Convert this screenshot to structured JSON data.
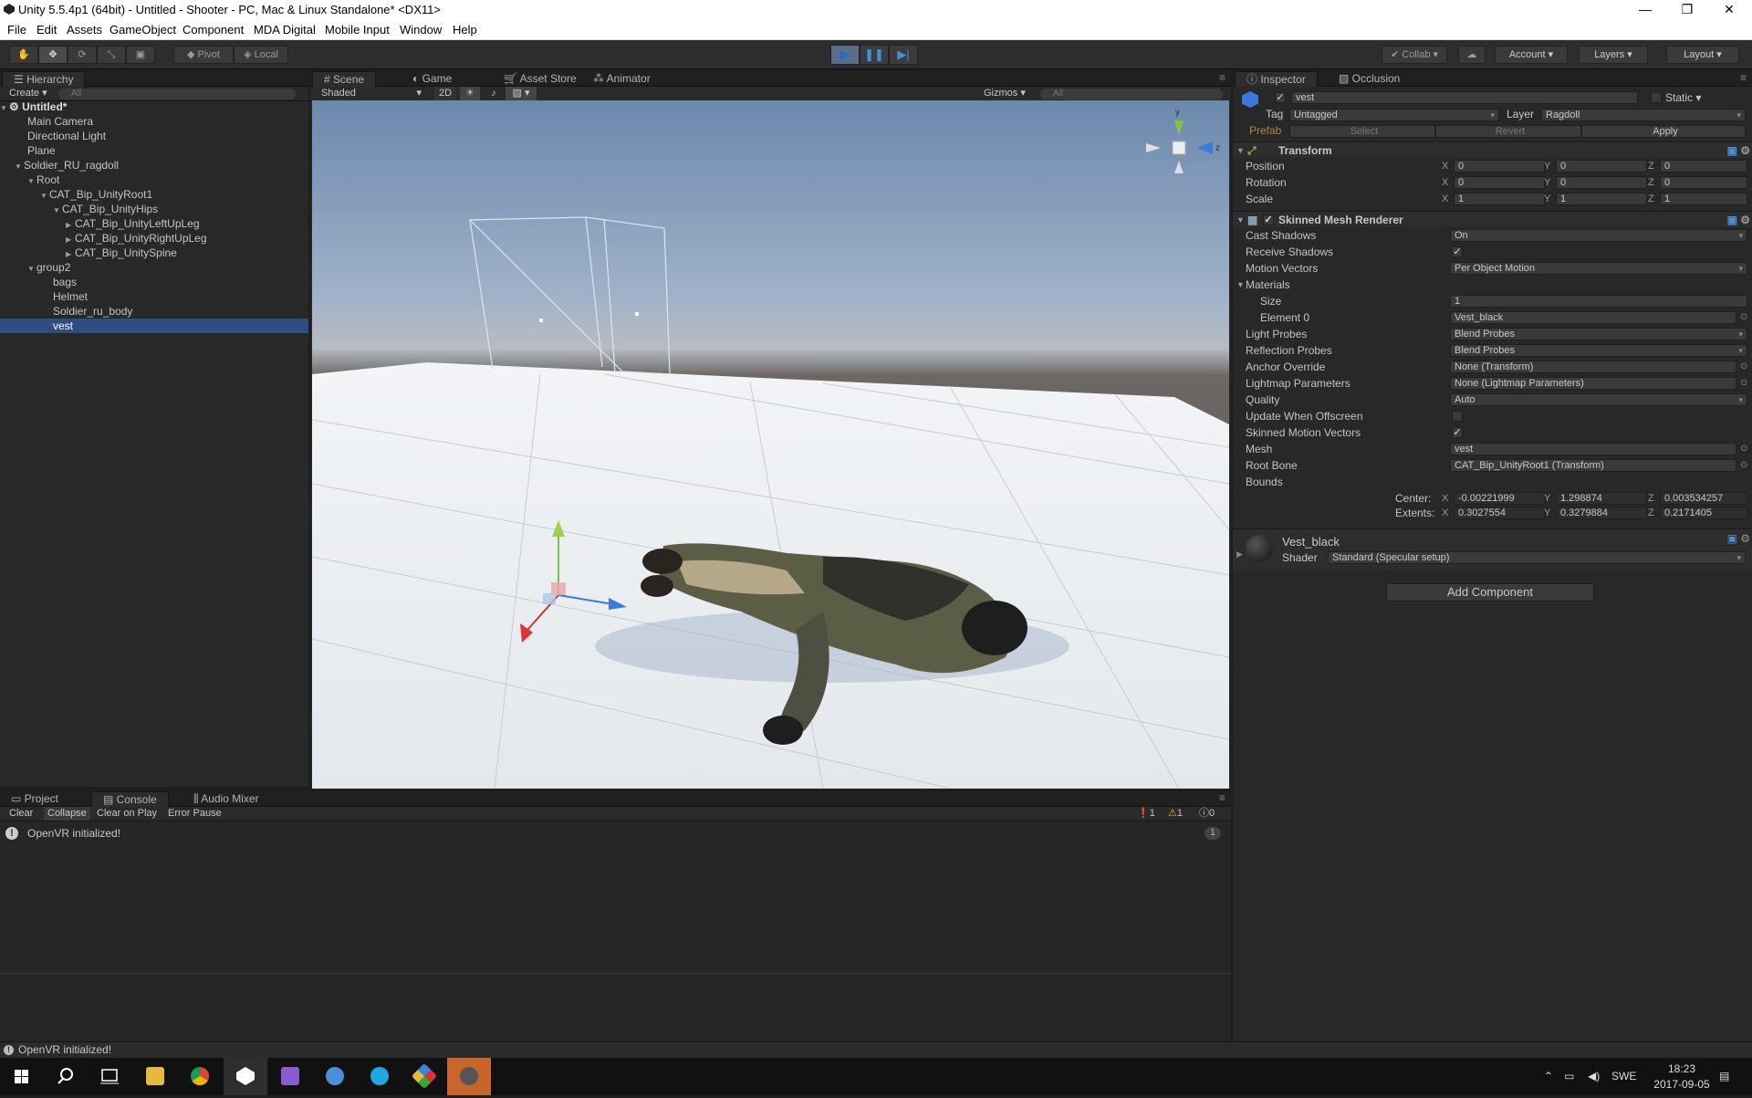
{
  "window": {
    "title": "Unity 5.5.4p1 (64bit) - Untitled - Shooter - PC, Mac & Linux Standalone* <DX11>",
    "minimize": "—",
    "maximize": "❐",
    "close": "✕"
  },
  "menu": [
    "File",
    "Edit",
    "Assets",
    "GameObject",
    "Component",
    "MDA Digital",
    "Mobile Input",
    "Window",
    "Help"
  ],
  "toolbar": {
    "pivot": "Pivot",
    "local": "Local",
    "collab": "Collab",
    "account": "Account",
    "layers": "Layers",
    "layout": "Layout"
  },
  "hierarchy": {
    "tab": "Hierarchy",
    "create": "Create",
    "search_placeholder": "All",
    "scene_name": "Untitled*",
    "items": [
      {
        "label": "Main Camera"
      },
      {
        "label": "Directional Light"
      },
      {
        "label": "Plane"
      },
      {
        "label": "Soldier_RU_ragdoll"
      },
      {
        "label": "Root"
      },
      {
        "label": "CAT_Bip_UnityRoot1"
      },
      {
        "label": "CAT_Bip_UnityHips"
      },
      {
        "label": "CAT_Bip_UnityLeftUpLeg"
      },
      {
        "label": "CAT_Bip_UnityRightUpLeg"
      },
      {
        "label": "CAT_Bip_UnitySpine"
      },
      {
        "label": "group2"
      },
      {
        "label": "bags"
      },
      {
        "label": "Helmet"
      },
      {
        "label": "Soldier_ru_body"
      },
      {
        "label": "vest"
      }
    ]
  },
  "scene": {
    "tabs": [
      "Scene",
      "Game",
      "Asset Store",
      "Animator"
    ],
    "shading": "Shaded",
    "mode_2d": "2D",
    "gizmos": "Gizmos",
    "search_placeholder": "All",
    "gizmo_axes": {
      "y": "y",
      "z": "z"
    }
  },
  "console": {
    "tabs": [
      "Project",
      "Console",
      "Audio Mixer"
    ],
    "buttons": [
      "Clear",
      "Collapse",
      "Clear on Play",
      "Error Pause"
    ],
    "counts": {
      "info": "1",
      "warn": "1",
      "error": "0"
    },
    "message": "OpenVR initialized!",
    "message_count": "1"
  },
  "inspector": {
    "tabs": [
      "Inspector",
      "Occlusion"
    ],
    "object_name": "vest",
    "static": "Static",
    "tag_label": "Tag",
    "tag_value": "Untagged",
    "layer_label": "Layer",
    "layer_value": "Ragdoll",
    "prefab": "Prefab",
    "select": "Select",
    "revert": "Revert",
    "apply": "Apply",
    "transform": {
      "title": "Transform",
      "position": {
        "label": "Position",
        "x": "0",
        "y": "0",
        "z": "0"
      },
      "rotation": {
        "label": "Rotation",
        "x": "0",
        "y": "0",
        "z": "0"
      },
      "scale": {
        "label": "Scale",
        "x": "1",
        "y": "1",
        "z": "1"
      }
    },
    "smr": {
      "title": "Skinned Mesh Renderer",
      "rows": [
        {
          "label": "Cast Shadows",
          "value": "On",
          "kind": "drop"
        },
        {
          "label": "Receive Shadows",
          "value": "✓",
          "kind": "check"
        },
        {
          "label": "Motion Vectors",
          "value": "Per Object Motion",
          "kind": "drop"
        },
        {
          "label": "Materials",
          "value": "",
          "kind": "fold"
        },
        {
          "label": "Size",
          "value": "1",
          "kind": "field",
          "indent": true
        },
        {
          "label": "Element 0",
          "value": "Vest_black",
          "kind": "obj",
          "indent": true
        },
        {
          "label": "Light Probes",
          "value": "Blend Probes",
          "kind": "drop"
        },
        {
          "label": "Reflection Probes",
          "value": "Blend Probes",
          "kind": "drop"
        },
        {
          "label": "Anchor Override",
          "value": "None (Transform)",
          "kind": "obj"
        },
        {
          "label": "Lightmap Parameters",
          "value": "None (Lightmap Parameters)",
          "kind": "obj"
        },
        {
          "label": "Quality",
          "value": "Auto",
          "kind": "drop"
        },
        {
          "label": "Update When Offscreen",
          "value": "",
          "kind": "check"
        },
        {
          "label": "Skinned Motion Vectors",
          "value": "✓",
          "kind": "check"
        },
        {
          "label": "Mesh",
          "value": "vest",
          "kind": "obj"
        },
        {
          "label": "Root Bone",
          "value": "CAT_Bip_UnityRoot1 (Transform)",
          "kind": "obj"
        },
        {
          "label": "Bounds",
          "value": "",
          "kind": "label"
        }
      ],
      "center": {
        "label": "Center:",
        "x": "-0.00221999",
        "y": "1.298874",
        "z": "0.003534257"
      },
      "extents": {
        "label": "Extents:",
        "x": "0.3027554",
        "y": "0.3279884",
        "z": "0.2171405"
      }
    },
    "material": {
      "name": "Vest_black",
      "shader_label": "Shader",
      "shader_value": "Standard (Specular setup)"
    },
    "add_component": "Add Component"
  },
  "status": "OpenVR initialized!",
  "taskbar": {
    "lang": "SWE",
    "time": "18:23",
    "date": "2017-09-05"
  }
}
